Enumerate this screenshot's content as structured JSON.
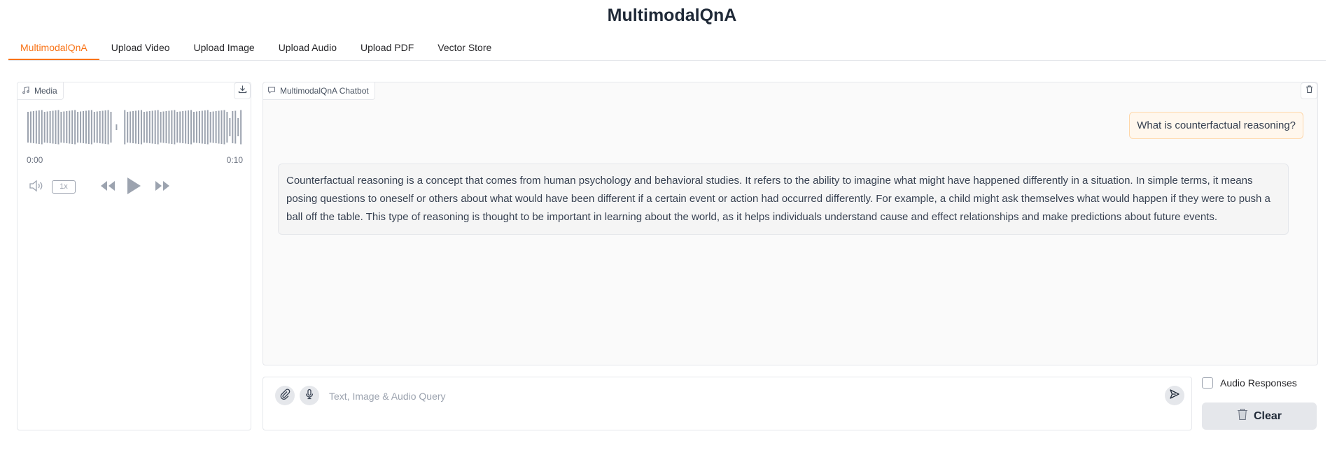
{
  "app": {
    "title": "MultimodalQnA"
  },
  "tabs": [
    {
      "label": "MultimodalQnA",
      "active": true
    },
    {
      "label": "Upload Video",
      "active": false
    },
    {
      "label": "Upload Image",
      "active": false
    },
    {
      "label": "Upload Audio",
      "active": false
    },
    {
      "label": "Upload PDF",
      "active": false
    },
    {
      "label": "Vector Store",
      "active": false
    }
  ],
  "media": {
    "label": "Media",
    "time_start": "0:00",
    "time_end": "0:10",
    "speed": "1x",
    "icons": [
      "music-note-icon",
      "download-icon",
      "volume-icon",
      "rewind-icon",
      "play-icon",
      "fast-forward-icon"
    ]
  },
  "chatbot": {
    "label": "MultimodalQnA Chatbot",
    "messages": [
      {
        "role": "user",
        "text": "What is counterfactual reasoning?"
      },
      {
        "role": "assistant",
        "text": "Counterfactual reasoning is a concept that comes from human psychology and behavioral studies. It refers to the ability to imagine what might have happened differently in a situation. In simple terms, it means posing questions to oneself or others about what would have been different if a certain event or action had occurred differently. For example, a child might ask themselves what would happen if they were to push a ball off the table. This type of reasoning is thought to be important in learning about the world, as it helps individuals understand cause and effect relationships and make predictions about future events."
      }
    ]
  },
  "query": {
    "placeholder": "Text, Image & Audio Query",
    "value": ""
  },
  "audio_responses": {
    "label": "Audio Responses",
    "checked": false
  },
  "clear_button": {
    "label": "Clear"
  },
  "colors": {
    "accent": "#f97316",
    "user_bubble": "#fff7ed",
    "bot_bubble": "#f5f5f5"
  }
}
